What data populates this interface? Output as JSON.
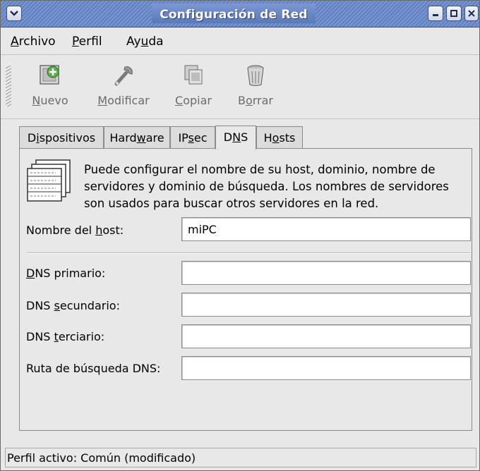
{
  "window": {
    "title": "Configuración de Red"
  },
  "menubar": {
    "items": [
      {
        "label_pre": "",
        "mnemonic": "A",
        "label_post": "rchivo"
      },
      {
        "label_pre": "",
        "mnemonic": "P",
        "label_post": "erfil"
      },
      {
        "label_pre": "Ay",
        "mnemonic": "u",
        "label_post": "da"
      }
    ]
  },
  "toolbar": {
    "buttons": [
      {
        "icon": "new-device-icon",
        "label_pre": "",
        "mnemonic": "N",
        "label_post": "uevo"
      },
      {
        "icon": "wrench-icon",
        "label_pre": "",
        "mnemonic": "M",
        "label_post": "odificar"
      },
      {
        "icon": "copy-icon",
        "label_pre": "",
        "mnemonic": "C",
        "label_post": "opiar"
      },
      {
        "icon": "trash-icon",
        "label_pre": "B",
        "mnemonic": "o",
        "label_post": "rrar"
      }
    ]
  },
  "tabs": [
    {
      "label_pre": "D",
      "mnemonic": "i",
      "label_post": "spositivos",
      "active": false
    },
    {
      "label_pre": "Hard",
      "mnemonic": "w",
      "label_post": "are",
      "active": false
    },
    {
      "label_pre": "IP",
      "mnemonic": "s",
      "label_post": "ec",
      "active": false
    },
    {
      "label_pre": "D",
      "mnemonic": "N",
      "label_post": "S",
      "active": true
    },
    {
      "label_pre": "H",
      "mnemonic": "o",
      "label_post": "sts",
      "active": false
    }
  ],
  "dns_panel": {
    "info_icon": "dns-table-icon",
    "info_lines": [
      "Puede configurar el nombre de su host, dominio, nombre de",
      "servidores y dominio de búsqueda. Los nombres de servidores",
      "son usados para buscar otros servidores en la red."
    ],
    "hostname": {
      "label_pre": "Nombre del ",
      "mnemonic": "h",
      "label_post": "ost:",
      "value": "miPC"
    },
    "primary_dns": {
      "label_pre": "",
      "mnemonic": "D",
      "label_post": "NS primario:",
      "value": ""
    },
    "secondary_dns": {
      "label_pre": "DNS ",
      "mnemonic": "s",
      "label_post": "ecundario:",
      "value": ""
    },
    "tertiary_dns": {
      "label_pre": "DNS ",
      "mnemonic": "t",
      "label_post": "erciario:",
      "value": ""
    },
    "search_path": {
      "label_pre": "Ruta de búsqueda DNS:",
      "mnemonic": "",
      "label_post": "",
      "value": ""
    }
  },
  "statusbar": {
    "text": "Perfil activo: Común (modificado)"
  },
  "colors": {
    "titlebar": "#5f7fbf",
    "window_bg": "#e8e8e8",
    "disabled_text": "#6b6b6b"
  }
}
